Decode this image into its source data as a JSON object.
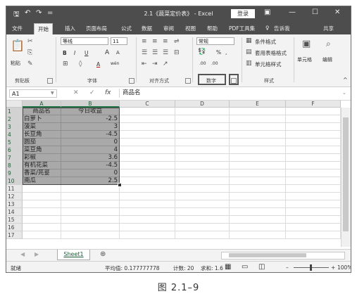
{
  "titlebar": {
    "title": "2.1《蔬菜定价表》 - Excel",
    "login_label": "登录",
    "qa_save_icon": "save-icon",
    "qa_undo": "↶",
    "qa_redo": "↷",
    "qa_more": "=",
    "ribbon_display_icon": "▣",
    "minimize": "—",
    "maximize": "☐",
    "close": "✕"
  },
  "tabs": [
    "文件",
    "开始",
    "插入",
    "页面布局",
    "公式",
    "数据",
    "审阅",
    "视图",
    "帮助",
    "PDF工具集"
  ],
  "active_tab": "开始",
  "tell_me": "告诉我",
  "share": "共享",
  "ribbon": {
    "paste_label": "粘贴",
    "clipboard_label": "剪贴板",
    "font_name": "等线",
    "font_size": "11",
    "bold": "B",
    "italic": "I",
    "underline": "U",
    "grow_font": "A",
    "shrink_font": "A",
    "font_color": "A",
    "phonetic": "wén",
    "font_label": "字体",
    "align_label": "对齐方式",
    "number_format": "常规",
    "currency": "%",
    "comma": ",",
    "decimals": ".00",
    "number_label": "数字",
    "cond_format": "条件格式",
    "table_format": "套用表格格式",
    "cell_styles": "单元格样式",
    "styles_label": "样式",
    "cells_label": "单元格",
    "edit_label": "编辑"
  },
  "formula_bar": {
    "name_box": "A1",
    "cancel": "✕",
    "enter": "✓",
    "fx": "fx",
    "content": "商品名"
  },
  "columns": [
    "A",
    "B",
    "C",
    "D",
    "E",
    "F"
  ],
  "row_numbers": [
    "1",
    "2",
    "3",
    "4",
    "5",
    "6",
    "7",
    "8",
    "9",
    "10",
    "11",
    "12",
    "13",
    "14",
    "15",
    "16",
    "17"
  ],
  "table": {
    "headers": [
      "商品名",
      "今日收益"
    ],
    "rows": [
      [
        "白萝卜",
        "-2.5"
      ],
      [
        "菠菜",
        "3"
      ],
      [
        "长豆角",
        "-4.5"
      ],
      [
        "圆茄",
        "0"
      ],
      [
        "菜豆角",
        "4"
      ],
      [
        "彩椒",
        "3.6"
      ],
      [
        "有机花菜",
        "-4.5"
      ],
      [
        "香菜/芫荽",
        "0"
      ],
      [
        "南瓜",
        "2.5"
      ]
    ]
  },
  "sheet": {
    "active_sheet": "Sheet1",
    "add_sheet": "⊕"
  },
  "status": {
    "mode": "就绪",
    "average": "平均值: 0.177777778",
    "count": "计数: 20",
    "sum": "求和: 1.6",
    "zoom": "100%"
  },
  "caption": "图 2.1–9"
}
